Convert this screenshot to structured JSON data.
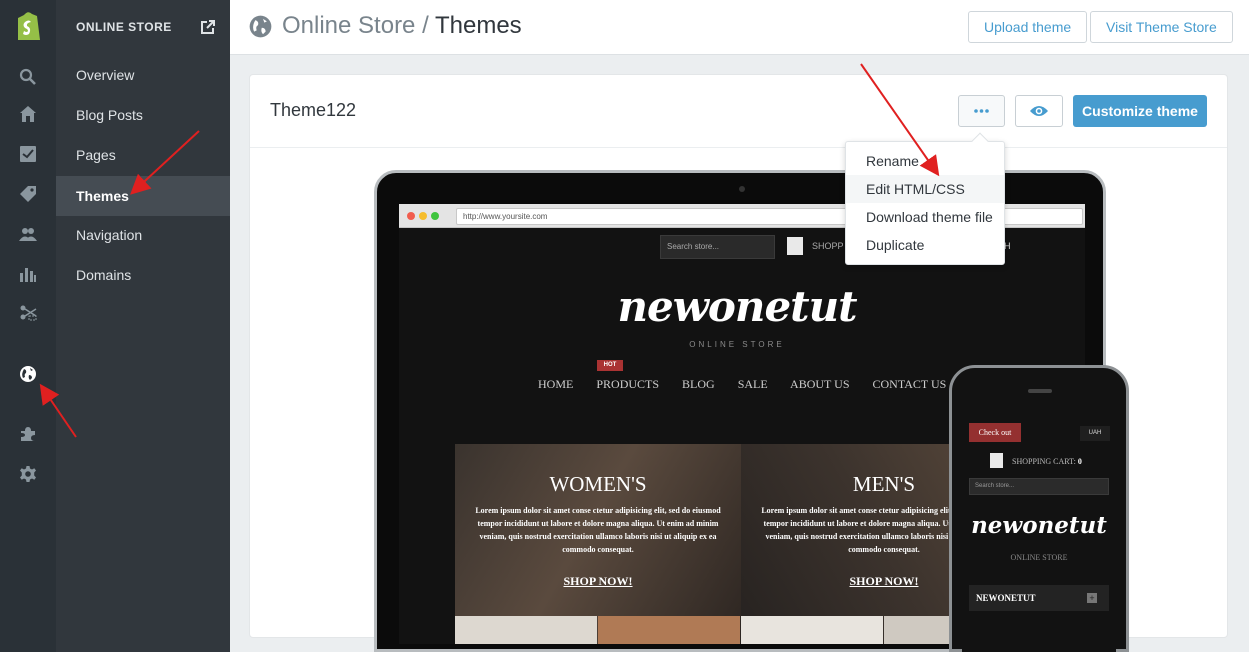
{
  "sidebar": {
    "section_title": "ONLINE STORE",
    "items": [
      {
        "label": "Overview"
      },
      {
        "label": "Blog Posts"
      },
      {
        "label": "Pages"
      },
      {
        "label": "Themes"
      },
      {
        "label": "Navigation"
      },
      {
        "label": "Domains"
      }
    ],
    "active_item": "Themes",
    "icons": [
      "shopify-logo",
      "search-icon",
      "home-icon",
      "orders-icon",
      "tag-icon",
      "customers-icon",
      "reports-icon",
      "discounts-icon",
      "online-store-globe-icon",
      "apps-puzzle-icon",
      "settings-gear-icon"
    ]
  },
  "header": {
    "breadcrumb_parent": "Online Store",
    "separator": "/",
    "title": "Themes",
    "upload_label": "Upload theme",
    "visit_store_label": "Visit Theme Store"
  },
  "theme_card": {
    "name": "Theme122",
    "more_icon": "ellipsis-icon",
    "preview_icon": "eye-icon",
    "customize_label": "Customize theme"
  },
  "dropdown": {
    "options": [
      {
        "label": "Rename"
      },
      {
        "label": "Edit HTML/CSS"
      },
      {
        "label": "Download theme file"
      },
      {
        "label": "Duplicate"
      }
    ],
    "highlighted": "Edit HTML/CSS"
  },
  "preview": {
    "url": "http://www.yoursite.com",
    "search_placeholder": "Search store...",
    "shopping_text": "SHOPP",
    "currency_fragment": "H",
    "logo": "newonetut",
    "logo_sub": "ONLINE STORE",
    "hot_badge": "HOT",
    "menu": [
      "HOME",
      "PRODUCTS",
      "BLOG",
      "SALE",
      "ABOUT US",
      "CONTACT US"
    ],
    "banners": [
      {
        "title": "WOMEN'S",
        "body": "Lorem ipsum dolor sit amet conse ctetur adipisicing elit, sed do eiusmod tempor incididunt ut labore et dolore magna aliqua. Ut enim ad minim veniam, quis nostrud exercitation ullamco laboris nisi ut aliquip ex ea commodo consequat.",
        "link": "SHOP NOW!"
      },
      {
        "title": "MEN'S",
        "body": "Lorem ipsum dolor sit amet conse ctetur adipisicing elit, sed do eiusmod tempor incididunt ut labore et dolore magna aliqua. Ut enim ad minim veniam, quis nostrud exercitation ullamco laboris nisi ut aliquip ex ea commodo consequat.",
        "link": "SHOP NOW!"
      }
    ]
  },
  "phone_preview": {
    "checkout_label": "Check out",
    "currency": "UAH",
    "cart_label": "SHOPPING CART:",
    "cart_count": "0",
    "search_placeholder": "Search store...",
    "logo": "newonetut",
    "logo_sub": "ONLINE STORE",
    "nav_label": "NEWONETUT"
  },
  "colors": {
    "rail_bg": "#2a3137",
    "nav_bg": "#31373d",
    "nav_active_bg": "#454c53",
    "accent": "#479ccf",
    "annotation_arrow": "#e02020"
  }
}
